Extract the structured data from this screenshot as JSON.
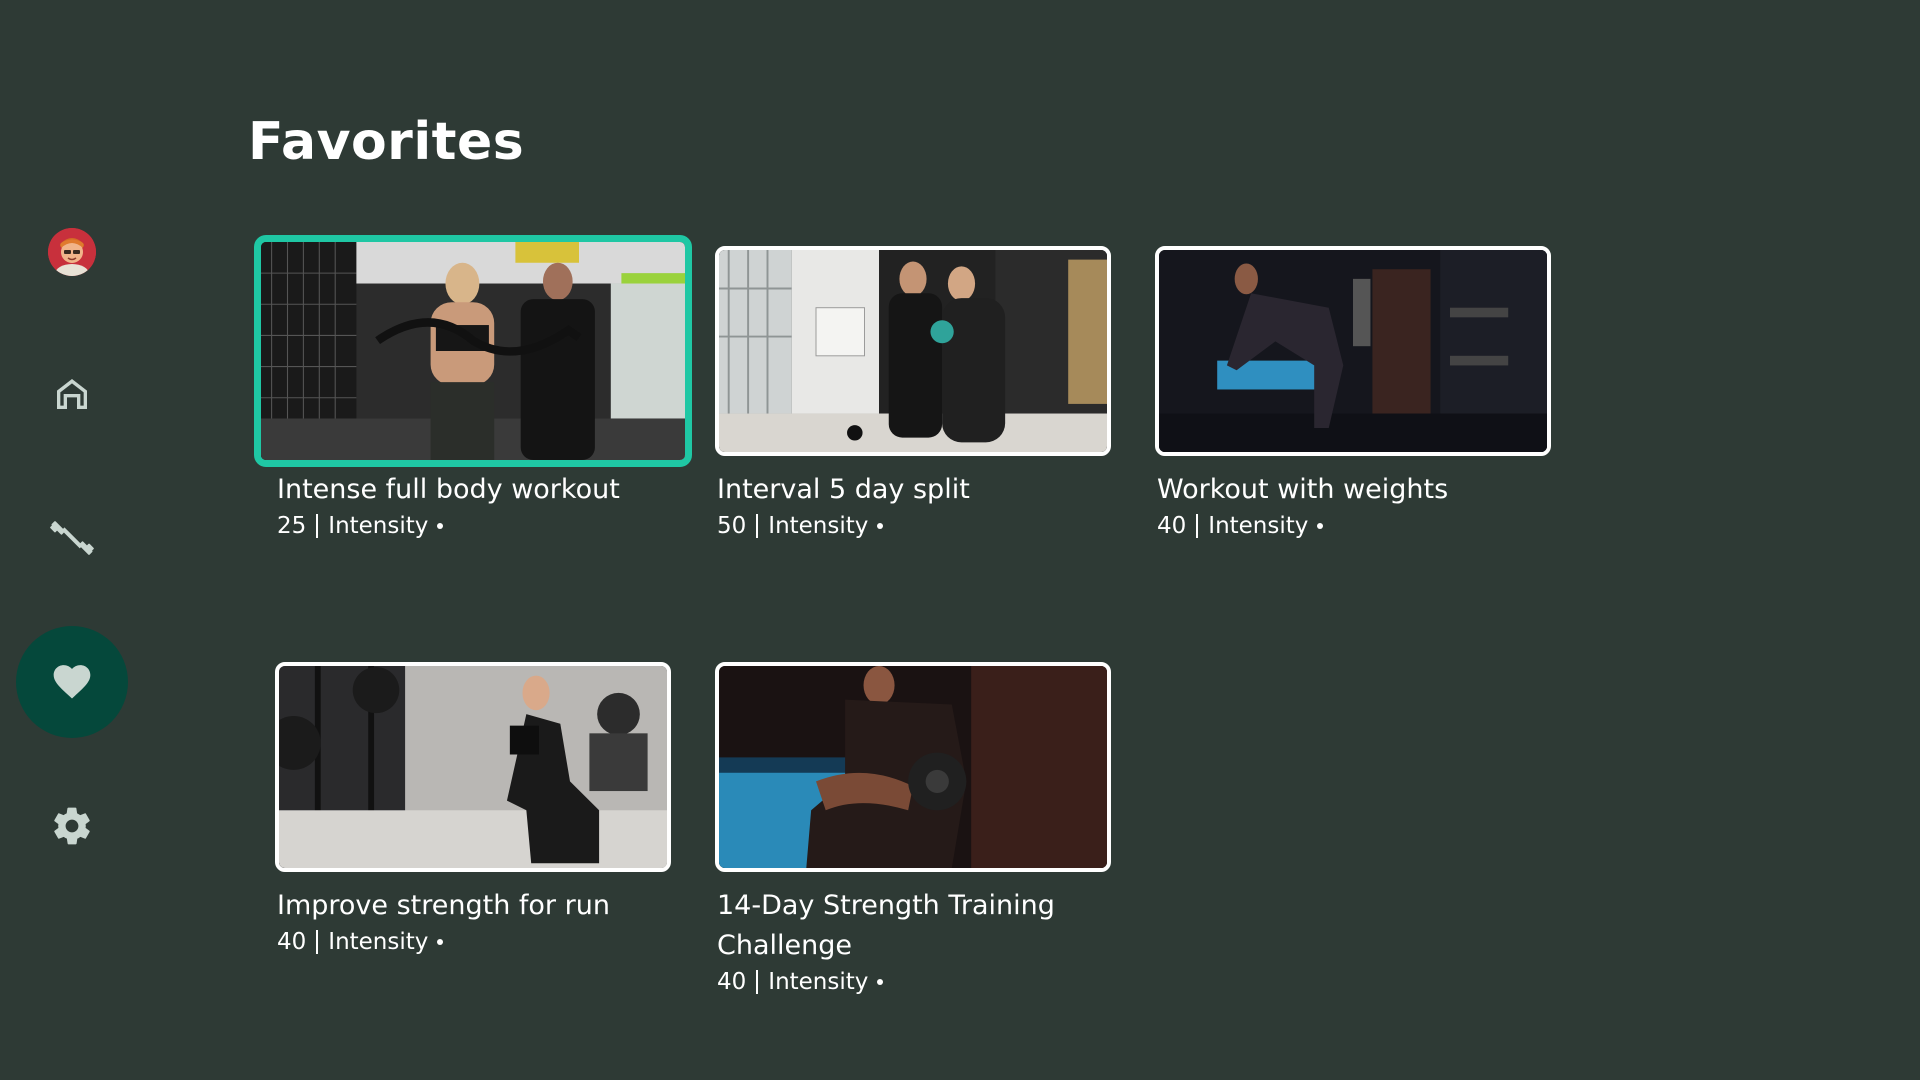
{
  "page": {
    "title": "Favorites"
  },
  "nav": {
    "items": [
      {
        "name": "profile",
        "icon": "avatar-icon",
        "active": false
      },
      {
        "name": "home",
        "icon": "home-icon",
        "active": false
      },
      {
        "name": "workouts",
        "icon": "dumbbell-icon",
        "active": false
      },
      {
        "name": "favorites",
        "icon": "heart-icon",
        "active": true
      },
      {
        "name": "settings",
        "icon": "gear-icon",
        "active": false
      }
    ]
  },
  "colors": {
    "background": "#2e3a35",
    "accent": "#1fc7a4",
    "active_nav": "#05483b",
    "icon": "#c9d6d0"
  },
  "workouts": [
    {
      "title": "Intense full body workout",
      "count": "25",
      "label": "Intensity",
      "focused": true
    },
    {
      "title": "Interval 5 day split",
      "count": "50",
      "label": "Intensity",
      "focused": false
    },
    {
      "title": "Workout with weights",
      "count": "40",
      "label": "Intensity",
      "focused": false
    },
    {
      "title": "Improve strength for run",
      "count": "40",
      "label": "Intensity",
      "focused": false
    },
    {
      "title": "14-Day Strength Training Challenge",
      "count": "40",
      "label": "Intensity",
      "focused": false
    }
  ]
}
